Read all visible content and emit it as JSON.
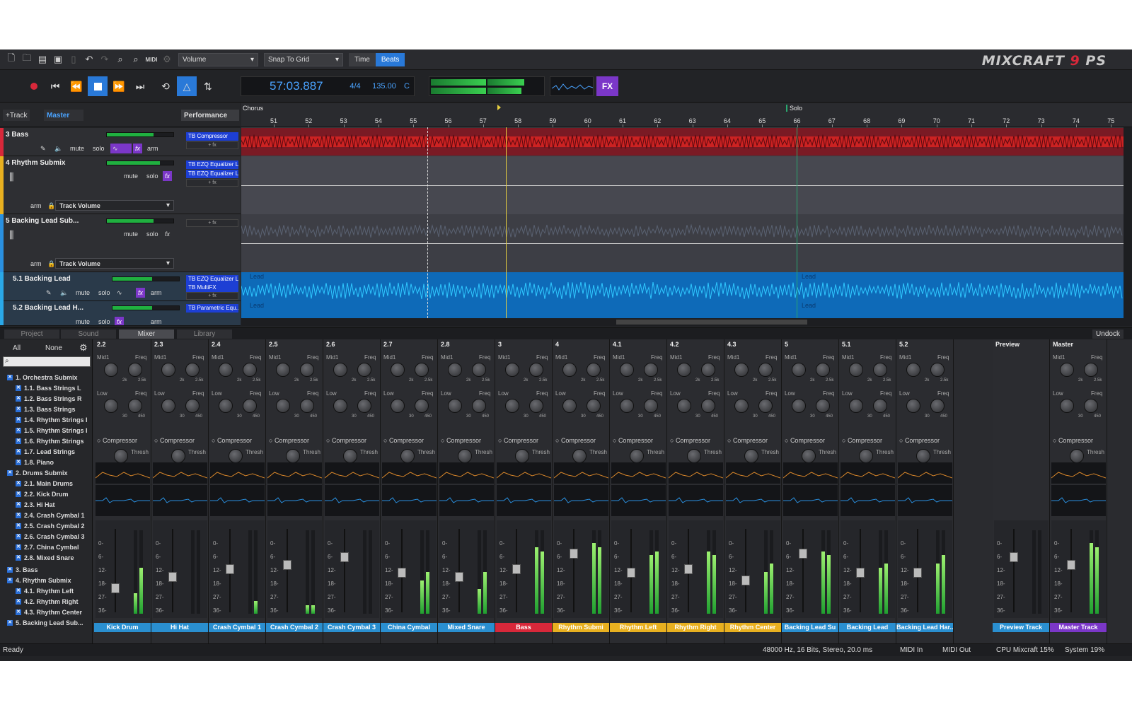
{
  "toolbar": {
    "volume_dropdown": "Volume",
    "snap_dropdown": "Snap To Grid",
    "time_btn": "Time",
    "beats_btn": "Beats",
    "logo_main": "MIXCRAFT",
    "logo_num": "9",
    "logo_ps": "PS"
  },
  "transport": {
    "time": "57:03.887",
    "signature": "4/4",
    "tempo": "135.00",
    "key": "C",
    "fx": "FX"
  },
  "header": {
    "add_track": "+Track",
    "master": "Master",
    "performance": "Performance"
  },
  "ruler": {
    "marker_chorus": "Chorus",
    "marker_solo": "Solo",
    "bars": [
      "51",
      "52",
      "53",
      "54",
      "55",
      "56",
      "57",
      "58",
      "59",
      "60",
      "61",
      "62",
      "63",
      "64",
      "65",
      "66",
      "67",
      "68",
      "69",
      "70",
      "71",
      "72",
      "73",
      "74",
      "75"
    ]
  },
  "tracks": [
    {
      "name": "3 Bass",
      "fx": [
        "TB Compressor"
      ],
      "fx_add": "+ fx",
      "mute": "mute",
      "solo": "solo",
      "fx_btn": "fx",
      "arm": "arm",
      "color": "#d8283a"
    },
    {
      "name": "4 Rhythm Submix",
      "fx": [
        "TB EZQ Equalizer L...",
        "TB EZQ Equalizer L..."
      ],
      "fx_add": "+ fx",
      "mute": "mute",
      "solo": "solo",
      "fx_btn": "fx",
      "arm": "arm",
      "auto": "Track Volume",
      "color": "#e8b020"
    },
    {
      "name": "5 Backing Lead Sub...",
      "fx": [],
      "fx_add": "+ fx",
      "mute": "mute",
      "solo": "solo",
      "fx_btn": "fx",
      "arm": "arm",
      "auto": "Track Volume",
      "color": "#2a90e0"
    },
    {
      "name": "5.1 Backing Lead",
      "fx": [
        "TB EZQ Equalizer L...",
        "TB MultiFX"
      ],
      "fx_add": "+ fx",
      "mute": "mute",
      "solo": "solo",
      "fx_btn": "fx",
      "arm": "arm",
      "color": "#2aa8e8"
    },
    {
      "name": "5.2 Backing Lead H...",
      "fx": [
        "TB Parametric Equ..."
      ],
      "fx_add": "",
      "mute": "mute",
      "solo": "solo",
      "fx_btn": "fx",
      "arm": "arm",
      "color": "#2aa8e8"
    }
  ],
  "clips": {
    "lead1": "Lead",
    "lead2": "Lead",
    "lead3": "Lead",
    "lead4": "Lead"
  },
  "tabs": [
    "Project",
    "Sound",
    "Mixer",
    "Library"
  ],
  "undock": "Undock",
  "side": {
    "all": "All",
    "none": "None",
    "items": [
      "1. Orchestra Submix",
      "1.1. Bass Strings L",
      "1.2. Bass Strings R",
      "1.3. Bass Strings",
      "1.4. Rhythm Strings I",
      "1.5. Rhythm Strings I",
      "1.6. Rhythm Strings",
      "1.7. Lead Strings",
      "1.8. Piano",
      "2. Drums Submix",
      "2.1. Main Drums",
      "2.2. Kick Drum",
      "2.3. Hi Hat",
      "2.4. Crash Cymbal 1",
      "2.5. Crash Cymbal 2",
      "2.6. Crash Cymbal 3",
      "2.7. China Cymbal",
      "2.8. Mixed Snare",
      "3. Bass",
      "4. Rhythm Submix",
      "4.1. Rhythm Left",
      "4.2. Rhythm Right",
      "4.3. Rhythm Center",
      "5. Backing Lead Sub..."
    ]
  },
  "mixer": {
    "mid1": "Mid1",
    "freq": "Freq",
    "low": "Low",
    "compressor": "Compressor",
    "thresh": "Thresh",
    "k25": "2.5k",
    "k2": "2k",
    "n30": "30",
    "n450": "450",
    "db": [
      "0-",
      "6-",
      "12-",
      "18-",
      "27-",
      "36-",
      "∞-"
    ],
    "channels": [
      {
        "num": "2.2",
        "label": "Kick Drum",
        "color": "#2a8fd0",
        "lvl": [
          0.25,
          0.55
        ],
        "fad": 0.3
      },
      {
        "num": "2.3",
        "label": "Hi Hat",
        "color": "#2a8fd0",
        "lvl": [
          0.0,
          0.0
        ],
        "fad": 0.45
      },
      {
        "num": "2.4",
        "label": "Crash Cymbal 1",
        "color": "#2a8fd0",
        "lvl": [
          0.0,
          0.15
        ],
        "fad": 0.55
      },
      {
        "num": "2.5",
        "label": "Crash Cymbal 2",
        "color": "#2a8fd0",
        "lvl": [
          0.1,
          0.1
        ],
        "fad": 0.6
      },
      {
        "num": "2.6",
        "label": "Crash Cymbal 3",
        "color": "#2a8fd0",
        "lvl": [
          0.0,
          0.0
        ],
        "fad": 0.7
      },
      {
        "num": "2.7",
        "label": "China Cymbal",
        "color": "#2a8fd0",
        "lvl": [
          0.4,
          0.5
        ],
        "fad": 0.5
      },
      {
        "num": "2.8",
        "label": "Mixed Snare",
        "color": "#2a8fd0",
        "lvl": [
          0.3,
          0.5
        ],
        "fad": 0.45
      },
      {
        "num": "3",
        "label": "Bass",
        "color": "#d8283a",
        "lvl": [
          0.8,
          0.75
        ],
        "fad": 0.55
      },
      {
        "num": "4",
        "label": "Rhythm Submi",
        "color": "#e8b020",
        "lvl": [
          0.85,
          0.8
        ],
        "fad": 0.75
      },
      {
        "num": "4.1",
        "label": "Rhythm Left",
        "color": "#e8b020",
        "lvl": [
          0.7,
          0.75
        ],
        "fad": 0.5
      },
      {
        "num": "4.2",
        "label": "Rhythm Right",
        "color": "#e8b020",
        "lvl": [
          0.75,
          0.7
        ],
        "fad": 0.55
      },
      {
        "num": "4.3",
        "label": "Rhythm Center",
        "color": "#e8b020",
        "lvl": [
          0.5,
          0.6
        ],
        "fad": 0.4
      },
      {
        "num": "5",
        "label": "Backing Lead Su",
        "color": "#2a8fd0",
        "lvl": [
          0.75,
          0.7
        ],
        "fad": 0.75
      },
      {
        "num": "5.1",
        "label": "Backing Lead",
        "color": "#2a8fd0",
        "lvl": [
          0.55,
          0.6
        ],
        "fad": 0.5
      },
      {
        "num": "5.2",
        "label": "Backing Lead Har...",
        "color": "#2a8fd0",
        "lvl": [
          0.6,
          0.7
        ],
        "fad": 0.5
      }
    ],
    "preview": {
      "num": "Preview",
      "label": "Preview Track",
      "color": "#2a8fd0"
    },
    "master": {
      "num": "Master",
      "label": "Master Track",
      "color": "#7b37c8",
      "lvl": [
        0.85,
        0.8
      ]
    }
  },
  "status": {
    "ready": "Ready",
    "audio": "48000 Hz, 16 Bits, Stereo, 20.0 ms",
    "midi_in": "MIDI In",
    "midi_out": "MIDI Out",
    "cpu": "CPU Mixcraft 15%",
    "system": "System 19%"
  }
}
